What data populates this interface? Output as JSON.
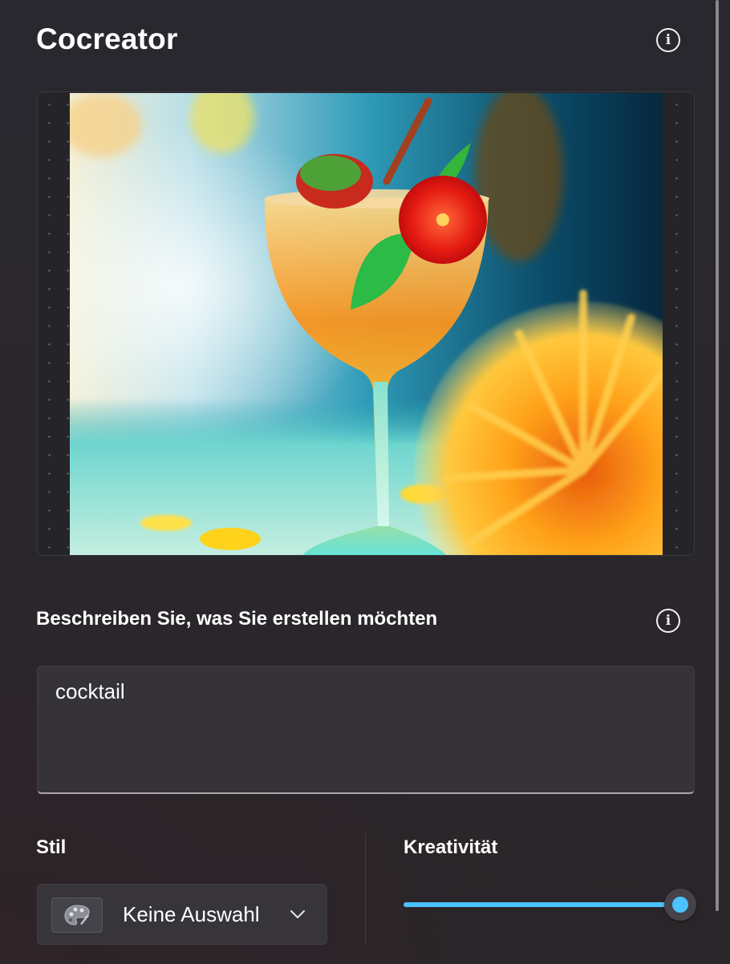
{
  "app": {
    "title": "Cocreator"
  },
  "icons": {
    "title_info": "info-icon",
    "prompt_info": "info-icon",
    "style_thumbnail": "palette-icon",
    "style_dropdown": "chevron-down-icon"
  },
  "canvas": {
    "image_subject": "cocktail"
  },
  "prompt": {
    "label": "Beschreiben Sie, was Sie erstellen möchten",
    "value": "cocktail"
  },
  "style": {
    "label": "Stil",
    "selected": "Keine Auswahl"
  },
  "creativity": {
    "label": "Kreativität",
    "value": 1.0
  },
  "colors": {
    "accent": "#4cc2ff",
    "panel_background": "#29282e",
    "input_background": "#363338"
  }
}
